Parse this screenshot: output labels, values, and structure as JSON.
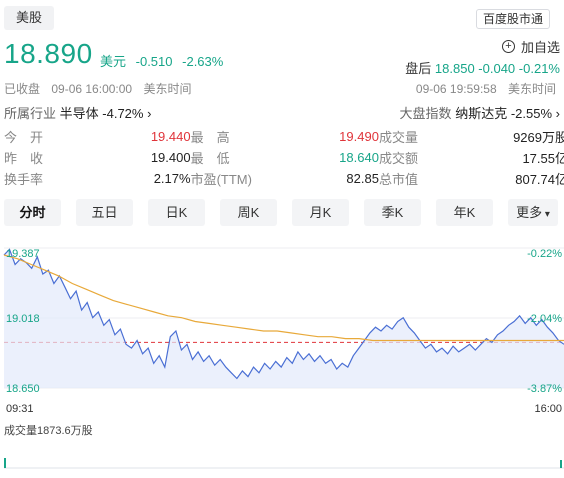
{
  "market_tag": "美股",
  "baidu_button": "百度股市通",
  "quote": {
    "price": "18.890",
    "currency": "美元",
    "change": "-0.510",
    "change_pct": "-2.63%"
  },
  "watch_label": "加自选",
  "after_hours": {
    "label": "盘后",
    "price": "18.850",
    "change": "-0.040",
    "change_pct": "-0.21%",
    "time": "09-06 19:59:58",
    "tz": "美东时间"
  },
  "status": {
    "label": "已收盘",
    "time": "09-06 16:00:00",
    "tz": "美东时间"
  },
  "industry": {
    "label": "所属行业",
    "name": "半导体",
    "change": "-4.72%",
    "chevron": "›"
  },
  "index": {
    "label": "大盘指数",
    "name": "纳斯达克",
    "change": "-2.55%",
    "chevron": "›"
  },
  "stats": [
    [
      {
        "label": "今　开",
        "value": "19.440",
        "color": "#e0343a"
      },
      {
        "label": "最　高",
        "value": "19.490",
        "color": "#e0343a"
      },
      {
        "label": "成交量",
        "value": "9269万股",
        "color": "#222222"
      }
    ],
    [
      {
        "label": "昨　收",
        "value": "19.400",
        "color": "#222222"
      },
      {
        "label": "最　低",
        "value": "18.640",
        "color": "#17a589"
      },
      {
        "label": "成交额",
        "value": "17.55亿",
        "color": "#222222"
      }
    ],
    [
      {
        "label": "换手率",
        "value": "2.17%",
        "color": "#222222"
      },
      {
        "label": "市盈(TTM)",
        "value": "82.85",
        "color": "#222222"
      },
      {
        "label": "总市值",
        "value": "807.74亿",
        "color": "#222222"
      }
    ]
  ],
  "tabs": [
    "分时",
    "五日",
    "日K",
    "周K",
    "月K",
    "季K",
    "年K",
    "更多"
  ],
  "active_tab": 0,
  "more_icon": "chevron-down-icon",
  "chart_data": {
    "type": "line",
    "y_labels": [
      "19.387",
      "19.018",
      "18.650"
    ],
    "pct_labels": [
      "-0.22%",
      "-2.04%",
      "-3.87%"
    ],
    "x_labels": [
      "09:31",
      "16:00"
    ],
    "ylim": [
      18.65,
      19.387
    ],
    "prev_close": 18.89,
    "series": [
      {
        "values": [
          19.35,
          19.38,
          19.3,
          19.33,
          19.31,
          19.28,
          19.34,
          19.25,
          19.27,
          19.2,
          19.24,
          19.18,
          19.12,
          19.16,
          19.06,
          19.1,
          19.02,
          19.05,
          18.98,
          19.01,
          18.93,
          18.96,
          18.88,
          18.86,
          18.9,
          18.83,
          18.86,
          18.78,
          18.82,
          18.76,
          18.92,
          18.95,
          18.85,
          18.88,
          18.8,
          18.84,
          18.79,
          18.82,
          18.77,
          18.8,
          18.76,
          18.73,
          18.7,
          18.74,
          18.71,
          18.76,
          18.73,
          18.78,
          18.75,
          18.79,
          18.76,
          18.81,
          18.78,
          18.84,
          18.8,
          18.83,
          18.79,
          18.82,
          18.78,
          18.8,
          18.75,
          18.78,
          18.76,
          18.82,
          18.86,
          18.9,
          18.94,
          18.97,
          18.95,
          18.98,
          18.96,
          19.0,
          19.02,
          18.97,
          18.94,
          18.9,
          18.86,
          18.88,
          18.84,
          18.86,
          18.83,
          18.87,
          18.84,
          18.86,
          18.88,
          18.85,
          18.88,
          18.91,
          18.89,
          18.93,
          18.95,
          18.98,
          19.0,
          19.03,
          18.99,
          19.02,
          18.98,
          19.01,
          18.97,
          18.94,
          18.9,
          18.88
        ]
      },
      {
        "values": [
          19.35,
          19.33,
          19.3,
          19.27,
          19.24,
          19.2,
          19.17,
          19.14,
          19.11,
          19.09,
          19.07,
          19.05,
          19.03,
          19.02,
          19.0,
          18.99,
          18.98,
          18.97,
          18.96,
          18.95,
          18.95,
          18.94,
          18.93,
          18.92,
          18.92,
          18.91,
          18.91,
          18.9,
          18.9,
          18.9,
          18.9,
          18.9,
          18.9,
          18.9,
          18.9,
          18.9,
          18.9,
          18.9,
          18.9,
          18.9,
          18.9,
          18.9
        ]
      }
    ],
    "volume": "成交量1873.6万股"
  }
}
